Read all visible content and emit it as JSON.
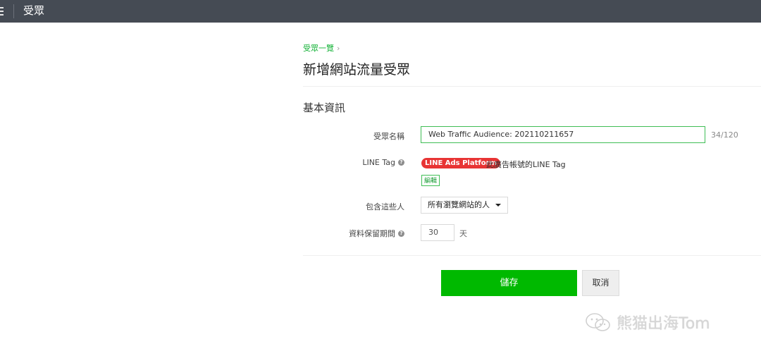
{
  "header": {
    "app_title": "受眾",
    "menu_icon": "menu-icon"
  },
  "breadcrumb": {
    "parent": "受眾一覽",
    "separator": "›"
  },
  "page": {
    "title": "新增網站流量受眾",
    "section_title": "基本資訊"
  },
  "form": {
    "audience_name_label": "受眾名稱",
    "audience_name_value": "Web Traffic Audience: 202110211657",
    "audience_name_counter": "34/120",
    "line_tag_label": "LINE Tag",
    "line_tag_badge": "LINE Ads Platform",
    "line_tag_text": "此廣告帳號的LINE Tag",
    "edit_label": "編輯",
    "include_label": "包含這些人",
    "include_selected": "所有瀏覽網站的人",
    "retention_label": "資料保留期間",
    "retention_value": "30",
    "retention_unit": "天"
  },
  "actions": {
    "save": "儲存",
    "cancel": "取消"
  },
  "watermark": {
    "text": "熊猫出海Tom"
  },
  "colors": {
    "topbar": "#454b54",
    "accent_green": "#00b900",
    "badge_red": "#e83434"
  }
}
